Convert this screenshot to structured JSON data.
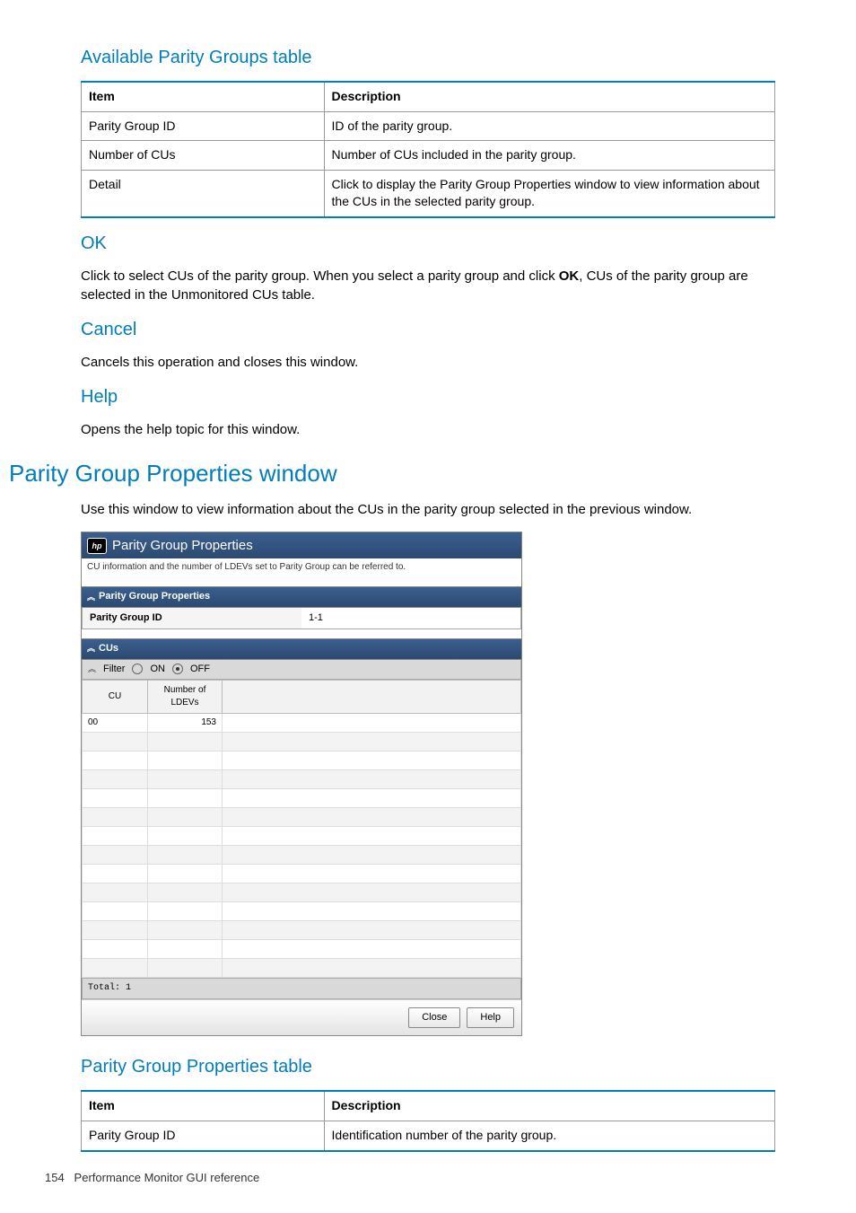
{
  "sec1": {
    "title": "Available Parity Groups table",
    "headers": [
      "Item",
      "Description"
    ],
    "rows": [
      [
        "Parity Group ID",
        "ID of the parity group."
      ],
      [
        "Number of CUs",
        "Number of CUs included in the parity group."
      ],
      [
        "Detail",
        "Click to display the Parity Group Properties window to view information about the CUs in the selected parity group."
      ]
    ]
  },
  "ok": {
    "title": "OK",
    "text_a": "Click to select CUs of the parity group. When you select a parity group and click ",
    "bold": "OK",
    "text_b": ", CUs of the parity group are selected in the Unmonitored CUs table."
  },
  "cancel": {
    "title": "Cancel",
    "text": "Cancels this operation and closes this window."
  },
  "help": {
    "title": "Help",
    "text": "Opens the help topic for this window."
  },
  "sec2": {
    "title": "Parity Group Properties window",
    "text": "Use this window to view information about the CUs in the parity group selected in the previous window."
  },
  "dialog": {
    "title": "Parity Group Properties",
    "subtitle": "CU information and the number of LDEVs set to Parity Group can be referred to.",
    "props_header": "Parity Group Properties",
    "pgid_label": "Parity Group ID",
    "pgid_value": "1-1",
    "cus_header": "CUs",
    "filter_label": "Filter",
    "on_label": "ON",
    "off_label": "OFF",
    "col_cu": "CU",
    "col_ldev": "Number of LDEVs",
    "row_cu": "00",
    "row_ldev": "153",
    "total": "Total: 1",
    "close": "Close",
    "help": "Help"
  },
  "sec3": {
    "title": "Parity Group Properties table",
    "headers": [
      "Item",
      "Description"
    ],
    "rows": [
      [
        "Parity Group ID",
        "Identification number of the parity group."
      ]
    ]
  },
  "footer": {
    "page": "154",
    "text": "Performance Monitor GUI reference"
  }
}
